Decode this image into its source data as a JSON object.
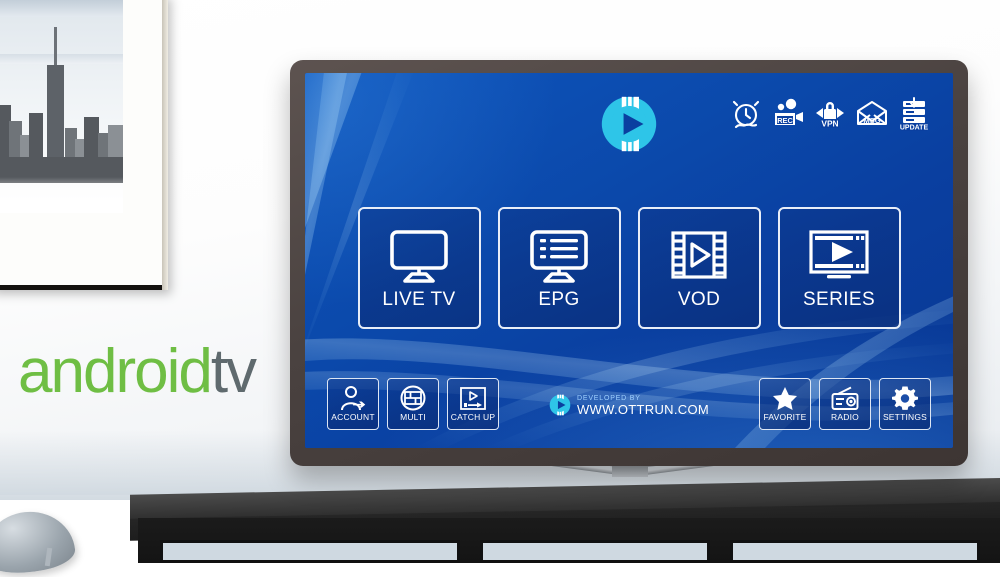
{
  "scene": {
    "brand_wordmark": {
      "part1": "android",
      "part2": "tv",
      "color1": "#6fbe44",
      "color2": "#5f6a6e"
    },
    "device": "television"
  },
  "app": {
    "screen_bg_color": "#0a3fa0",
    "accent_color": "#2ec5e8",
    "logo": {
      "name": "ottrun-play-logo"
    },
    "status_icons": [
      {
        "name": "alarm-clock-icon",
        "label": ""
      },
      {
        "name": "recorder-icon",
        "label": "REC"
      },
      {
        "name": "vpn-lock-icon",
        "label": "VPN"
      },
      {
        "name": "message-envelope-icon",
        "label": "MSG"
      },
      {
        "name": "update-server-icon",
        "label": "UPDATE"
      }
    ],
    "main_menu": [
      {
        "label": "LIVE TV",
        "icon": "tv-monitor-icon"
      },
      {
        "label": "EPG",
        "icon": "program-guide-icon"
      },
      {
        "label": "VOD",
        "icon": "film-strip-play-icon"
      },
      {
        "label": "SERIES",
        "icon": "series-screen-play-icon"
      }
    ],
    "bottom_left_buttons": [
      {
        "label": "ACCOUNT",
        "icon": "user-account-icon"
      },
      {
        "label": "MULTI",
        "icon": "multi-screen-icon"
      },
      {
        "label": "CATCH UP",
        "icon": "catch-up-icon"
      }
    ],
    "bottom_right_buttons": [
      {
        "label": "FAVORITE",
        "icon": "star-icon"
      },
      {
        "label": "RADIO",
        "icon": "radio-icon"
      },
      {
        "label": "SETTINGS",
        "icon": "gear-icon"
      }
    ],
    "footer": {
      "developed_by": "DEVELOPED BY",
      "website": "WWW.OTTRUN.COM",
      "logo": "ottrun-play-logo"
    }
  }
}
